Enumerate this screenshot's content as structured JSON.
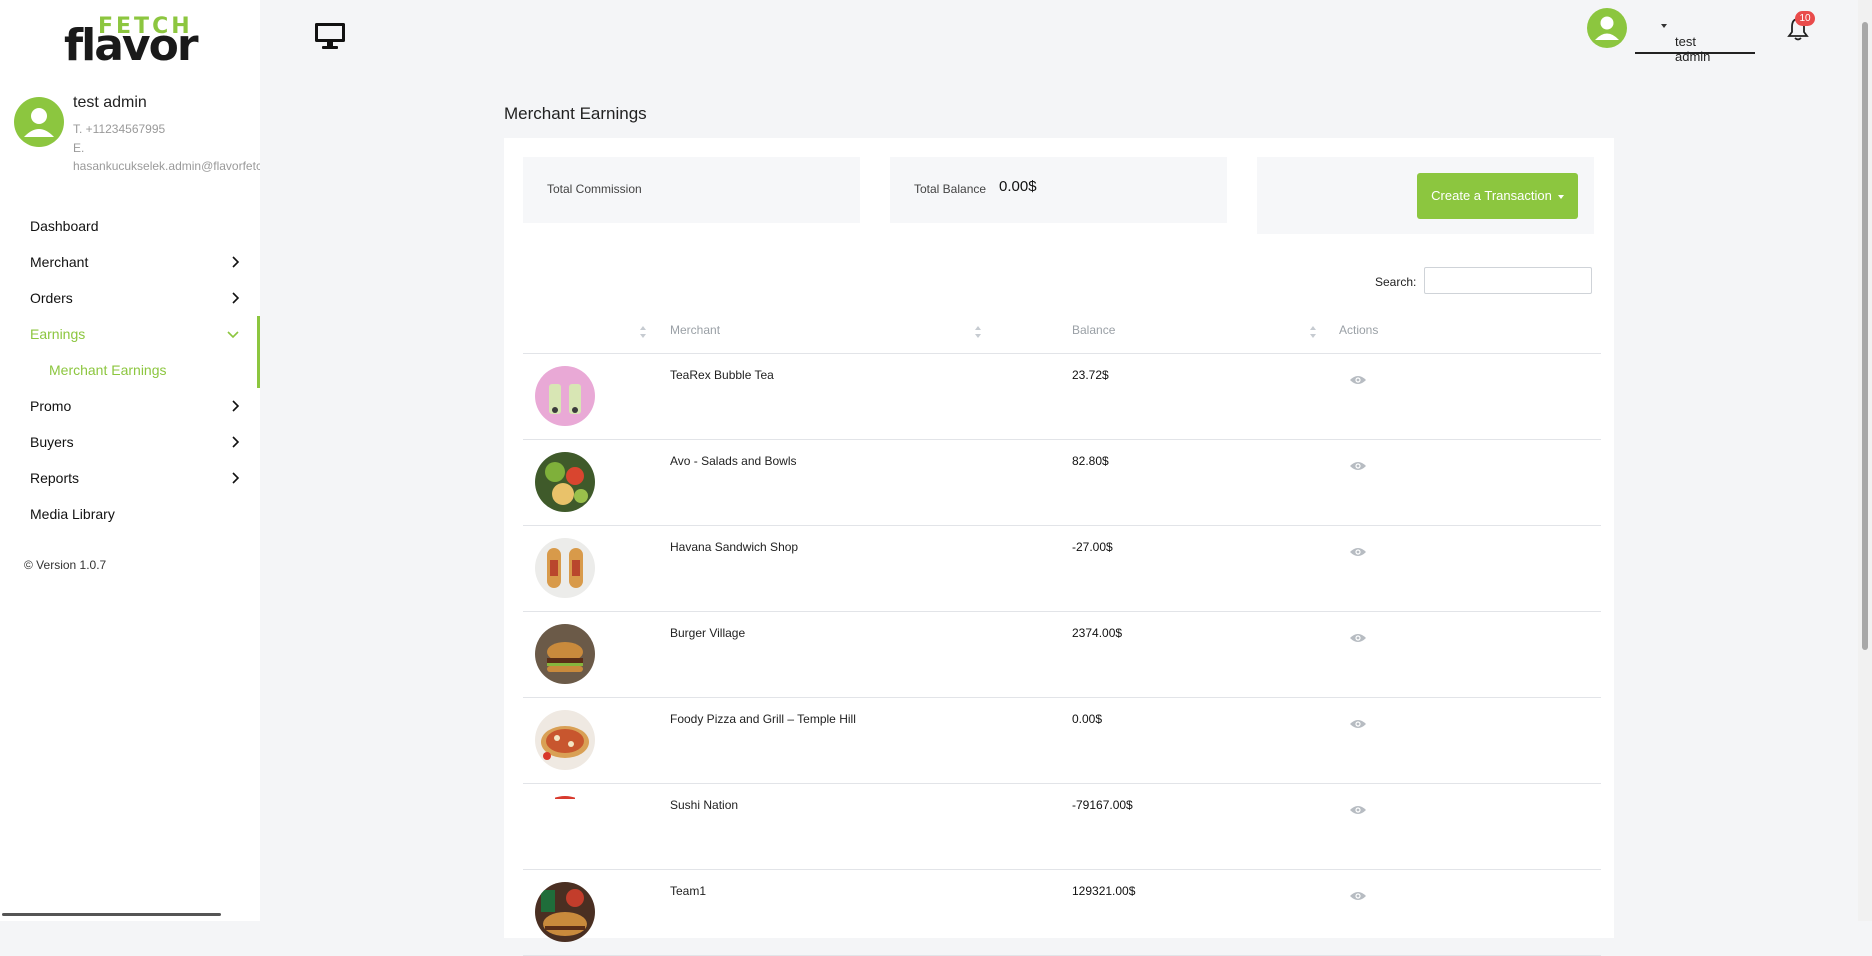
{
  "brand": {
    "line1": "FETCH",
    "line2": "flavor"
  },
  "profile": {
    "name": "test admin",
    "phone": "T. +11234567995",
    "email_prefix": "E.",
    "email": "hasankucukselek.admin@flavorfetch.com"
  },
  "nav": {
    "dashboard": "Dashboard",
    "merchant": "Merchant",
    "orders": "Orders",
    "earnings": "Earnings",
    "merchant_earnings": "Merchant Earnings",
    "promo": "Promo",
    "buyers": "Buyers",
    "reports": "Reports",
    "media_library": "Media Library"
  },
  "version": "© Version 1.0.7",
  "topbar": {
    "user": "test admin",
    "notifications": "10"
  },
  "page": {
    "title": "Merchant Earnings"
  },
  "stats": {
    "commission_label": "Total Commission",
    "balance_label": "Total Balance",
    "balance_value": "0.00$"
  },
  "actions": {
    "create_transaction": "Create a Transaction"
  },
  "search": {
    "label": "Search:",
    "value": ""
  },
  "table": {
    "headers": {
      "image": "",
      "merchant": "Merchant",
      "balance": "Balance",
      "actions": "Actions"
    },
    "rows": [
      {
        "merchant": "TeaRex Bubble Tea",
        "balance": "23.72$"
      },
      {
        "merchant": "Avo - Salads and Bowls",
        "balance": "82.80$"
      },
      {
        "merchant": "Havana Sandwich Shop",
        "balance": "-27.00$"
      },
      {
        "merchant": "Burger Village",
        "balance": "2374.00$"
      },
      {
        "merchant": "Foody Pizza and Grill – Temple Hill",
        "balance": "0.00$"
      },
      {
        "merchant": "Sushi Nation",
        "balance": "-79167.00$"
      },
      {
        "merchant": "Team1",
        "balance": "129321.00$"
      }
    ]
  },
  "colors": {
    "accent": "#8cc63f",
    "badge": "#e94b4b"
  }
}
